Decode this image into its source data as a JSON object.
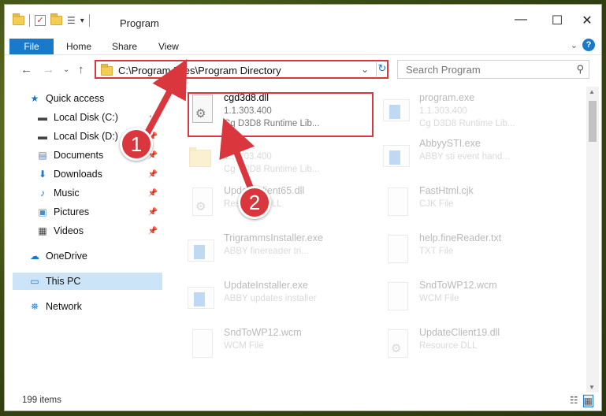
{
  "window": {
    "title": "Program"
  },
  "window_controls": {
    "minimize": "—",
    "maximize": "☐",
    "close": "✕"
  },
  "ribbon": {
    "tabs": [
      "File",
      "Home",
      "Share",
      "View"
    ],
    "help": "?"
  },
  "address": {
    "path": "C:\\Program Files\\Program Directory"
  },
  "search": {
    "placeholder": "Search Program"
  },
  "sidebar": {
    "quick_access": "Quick access",
    "items": [
      {
        "label": "Local Disk (C:)",
        "icon": "drive-icon",
        "pinned": true
      },
      {
        "label": "Local Disk (D:)",
        "icon": "drive-icon",
        "pinned": true
      },
      {
        "label": "Documents",
        "icon": "documents-icon",
        "pinned": true
      },
      {
        "label": "Downloads",
        "icon": "downloads-icon",
        "pinned": true
      },
      {
        "label": "Music",
        "icon": "music-icon",
        "pinned": true
      },
      {
        "label": "Pictures",
        "icon": "pictures-icon",
        "pinned": true
      },
      {
        "label": "Videos",
        "icon": "videos-icon",
        "pinned": true
      }
    ],
    "onedrive": "OneDrive",
    "this_pc": "This PC",
    "network": "Network"
  },
  "files": [
    {
      "name": "cgd3d8.dll",
      "line1": "1.1.303.400",
      "line2": "Cg D3D8 Runtime Lib...",
      "icon": "dll-icon",
      "highlighted": true
    },
    {
      "name": "program.exe",
      "line1": "1.1.303.400",
      "line2": "Cg D3D8 Runtime Lib...",
      "icon": "exe-icon"
    },
    {
      "name": "",
      "line1": "1.1.303.400",
      "line2": "Cg D3D8 Runtime Lib...",
      "icon": "folder-icon"
    },
    {
      "name": "AbbyySTI.exe",
      "line1": "ABBY sti event hand...",
      "line2": "",
      "icon": "exe-icon"
    },
    {
      "name": "UpdateClient65.dll",
      "line1": "Resource DLL",
      "line2": "",
      "icon": "dll-icon"
    },
    {
      "name": "FastHtml.cjk",
      "line1": "CJK File",
      "line2": "",
      "icon": "file-icon"
    },
    {
      "name": "TrigrammsInstaller.exe",
      "line1": "ABBY finereader tri...",
      "line2": "",
      "icon": "exe-icon"
    },
    {
      "name": "help.fineReader.txt",
      "line1": "TXT File",
      "line2": "",
      "icon": "file-icon"
    },
    {
      "name": "UpdateInstaller.exe",
      "line1": "ABBY updates installer",
      "line2": "",
      "icon": "exe-icon"
    },
    {
      "name": "SndToWP12.wcm",
      "line1": "WCM File",
      "line2": "",
      "icon": "file-icon"
    },
    {
      "name": "SndToWP12.wcm",
      "line1": "WCM File",
      "line2": "",
      "icon": "file-icon"
    },
    {
      "name": "UpdateClient19.dll",
      "line1": "Resource DLL",
      "line2": "",
      "icon": "dll-icon"
    }
  ],
  "status": {
    "count": "199 items"
  },
  "callouts": [
    "1",
    "2"
  ],
  "colors": {
    "accent": "#1979ca",
    "highlight": "#d9363e"
  }
}
